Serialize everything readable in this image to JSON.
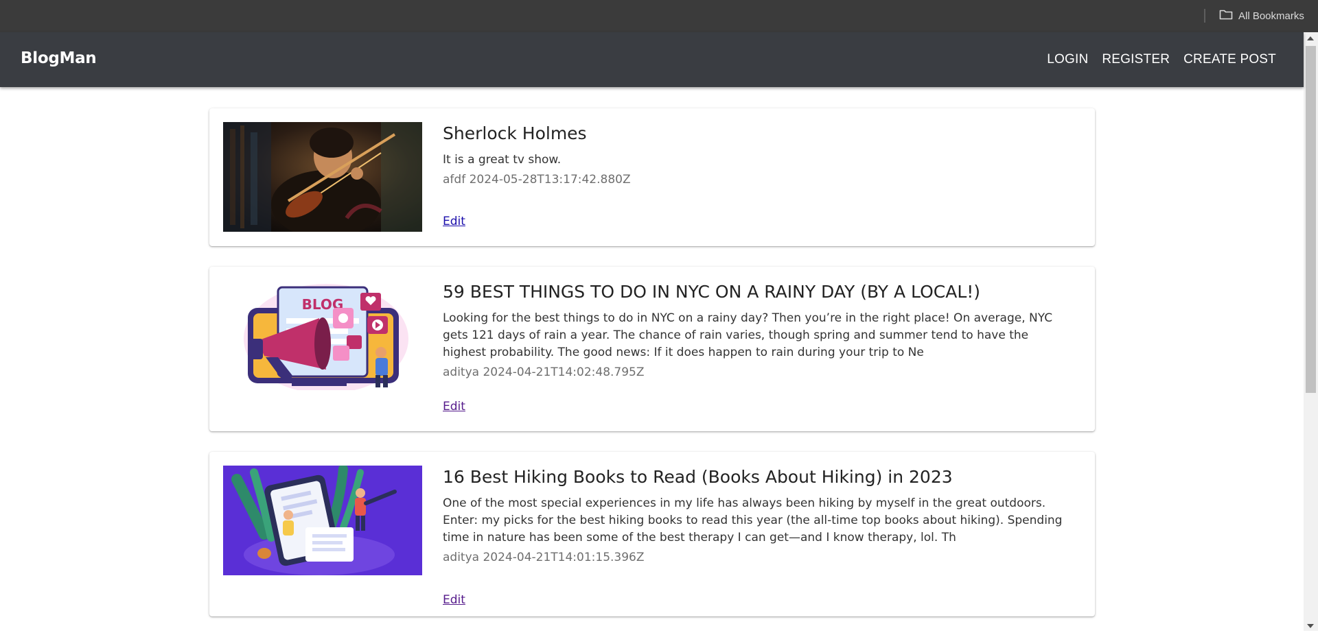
{
  "browser": {
    "all_bookmarks_label": "All Bookmarks"
  },
  "header": {
    "brand": "BlogMan",
    "nav": {
      "login": "LOGIN",
      "register": "REGISTER",
      "create_post": "CREATE POST"
    }
  },
  "posts": [
    {
      "title": "Sherlock Holmes",
      "summary": "It is a great tv show.",
      "author": "afdf",
      "timestamp": "2024-05-28T13:17:42.880Z",
      "edit_label": "Edit"
    },
    {
      "title": "59 BEST THINGS TO DO IN NYC ON A RAINY DAY (BY A LOCAL!)",
      "summary": "Looking for the best things to do in NYC on a rainy day? Then you’re in the right place! On average, NYC gets 121 days of rain a year. The chance of rain varies, though spring and summer tend to have the highest probability. The good news: If it does happen to rain during your trip to Ne",
      "author": "aditya",
      "timestamp": "2024-04-21T14:02:48.795Z",
      "edit_label": "Edit",
      "image_text": "BLOG"
    },
    {
      "title": "16 Best Hiking Books to Read (Books About Hiking) in 2023",
      "summary": "One of the most special experiences in my life has always been hiking by myself in the great outdoors. Enter: my picks for the best hiking books to read this year (the all-time top books about hiking). Spending time in nature has been some of the best therapy I can get—and I know therapy, lol. Th",
      "author": "aditya",
      "timestamp": "2024-04-21T14:01:15.396Z",
      "edit_label": "Edit"
    }
  ],
  "colors": {
    "header_bg": "#3a3d42",
    "bookmarks_bg": "#3b3b3b",
    "visited_link": "#551a8b",
    "link": "#1a0dab"
  }
}
